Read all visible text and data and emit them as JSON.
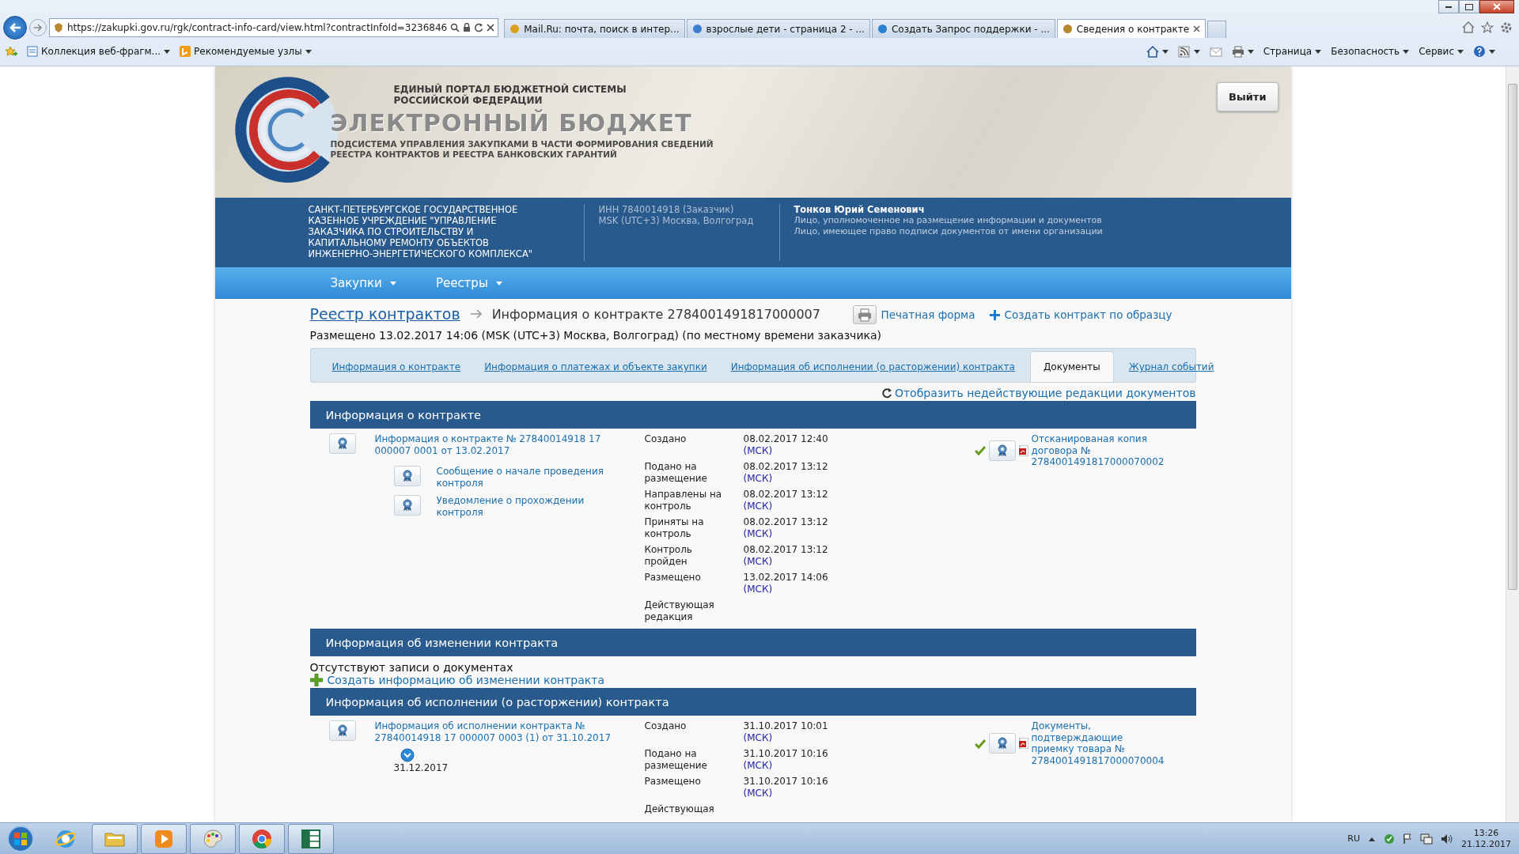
{
  "browser": {
    "url": "https://zakupki.gov.ru/rgk/contract-info-card/view.html?contractInfoId=3236846",
    "tabs": [
      {
        "title": "Mail.Ru: почта, поиск в интер...",
        "selected": false
      },
      {
        "title": "взрослые дети - страница 2 - ...",
        "selected": false
      },
      {
        "title": "Создать Запрос поддержки - ...",
        "selected": false
      },
      {
        "title": "Сведения о контракте",
        "selected": true
      }
    ],
    "favorites": [
      {
        "label": "Коллекция веб-фрагм..."
      },
      {
        "label": "Рекомендуемые узлы"
      }
    ],
    "commands": [
      {
        "label": "Страница"
      },
      {
        "label": "Безопасность"
      },
      {
        "label": "Сервис"
      }
    ]
  },
  "header": {
    "portal": [
      "ЕДИНЫЙ ПОРТАЛ БЮДЖЕТНОЙ СИСТЕМЫ",
      "РОССИЙСКОЙ ФЕДЕРАЦИИ"
    ],
    "title": "ЭЛЕКТРОННЫЙ БЮДЖЕТ",
    "subsystem": [
      "ПОДСИСТЕМА УПРАВЛЕНИЯ ЗАКУПКАМИ В ЧАСТИ ФОРМИРОВАНИЯ СВЕДЕНИЙ",
      "РЕЕСТРА КОНТРАКТОВ И РЕЕСТРА БАНКОВСКИХ ГАРАНТИЙ"
    ],
    "logout": "Выйти"
  },
  "organization": {
    "name_lines": [
      "САНКТ-ПЕТЕРБУРГСКОЕ ГОСУДАРСТВЕННОЕ",
      "КАЗЕННОЕ УЧРЕЖДЕНИЕ \"УПРАВЛЕНИЕ",
      "ЗАКАЗЧИКА ПО СТРОИТЕЛЬСТВУ И",
      "КАПИТАЛЬНОМУ РЕМОНТУ ОБЪЕКТОВ",
      "ИНЖЕНЕРНО-ЭНЕРГЕТИЧЕСКОГО КОМПЛЕКСА\""
    ],
    "inn": "ИНН 7840014918 (Заказчик)",
    "timezone": "MSK (UTC+3) Москва, Волгоград",
    "user": "Тонков Юрий Семенович",
    "roles": [
      "Лицо, уполномоченное на размещение информации и документов",
      "Лицо, имеющее право подписи документов от имени организации"
    ]
  },
  "nav": [
    {
      "label": "Закупки"
    },
    {
      "label": "Реестры"
    }
  ],
  "breadcrumb": {
    "link": "Реестр контрактов",
    "current": "Информация о контракте 2784001491817000007"
  },
  "actions": [
    {
      "kind": "print",
      "label": "Печатная форма"
    },
    {
      "kind": "create",
      "label": "Создать контракт по образцу"
    }
  ],
  "placed": "Размещено 13.02.2017 14:06 (MSK (UTC+3) Москва, Волгоград) (по местному времени заказчика)",
  "tabs": [
    {
      "label": "Информация о контракте",
      "selected": false
    },
    {
      "label": "Информация о платежах и объекте закупки",
      "selected": false
    },
    {
      "label": "Информация об исполнении (о расторжении) контракта",
      "selected": false
    },
    {
      "label": "Документы",
      "selected": true
    },
    {
      "label": "Журнал событий",
      "selected": false
    }
  ],
  "show_inactive": "Отобразить недействующие редакции документов",
  "sections": [
    {
      "title": "Информация о контракте",
      "kind": "documents",
      "documents": [
        {
          "title": "Информация о контракте № 27840014918 17 000007 0001 от 13.02.2017",
          "children": [
            {
              "title": "Сообщение о начале проведения контроля"
            },
            {
              "title": "Уведомление о прохождении контроля"
            }
          ],
          "events": [
            {
              "label": "Создано",
              "date": "08.02.2017 12:40",
              "tz": "(МСК)"
            },
            {
              "label": "Подано на размещение",
              "date": "08.02.2017 13:12",
              "tz": "(МСК)"
            },
            {
              "label": "Направлены на контроль",
              "date": "08.02.2017 13:12",
              "tz": "(МСК)"
            },
            {
              "label": "Приняты на контроль",
              "date": "08.02.2017 13:12",
              "tz": "(МСК)"
            },
            {
              "label": "Контроль пройден",
              "date": "08.02.2017 13:12",
              "tz": "(МСК)"
            },
            {
              "label": "Размещено",
              "date": "13.02.2017 14:06",
              "tz": "(МСК)"
            },
            {
              "label": "Действующая редакция"
            }
          ],
          "attachments": [
            {
              "title": "Отсканированая копия договора № 2784001491817000070002",
              "signed": true
            }
          ]
        }
      ]
    },
    {
      "title": "Информация об изменении контракта",
      "kind": "empty",
      "empty_text": "Отсутствуют записи о документах",
      "create_link": "Создать информацию об изменении контракта"
    },
    {
      "title": "Информация об исполнении (о расторжении) контракта",
      "kind": "documents",
      "documents": [
        {
          "title": "Информация об исполнении контракта № 27840014918 17 000007 0003 (1) от 31.10.2017",
          "expander": {
            "expanded": false
          },
          "date": "31.12.2017",
          "events": [
            {
              "label": "Создано",
              "date": "31.10.2017 10:01",
              "tz": "(МСК)"
            },
            {
              "label": "Подано на размещение",
              "date": "31.10.2017 10:16",
              "tz": "(МСК)"
            },
            {
              "label": "Размещено",
              "date": "31.10.2017 10:16",
              "tz": "(МСК)"
            },
            {
              "label": "Действующая"
            }
          ],
          "attachments": [
            {
              "title": "Документы, подтверждающие приемку товара № 2784001491817000070004",
              "signed": true
            }
          ]
        }
      ]
    }
  ],
  "taskbar": {
    "apps": [
      {
        "kind": "globe",
        "running": false
      },
      {
        "kind": "folder",
        "running": true
      },
      {
        "kind": "media",
        "running": true
      },
      {
        "kind": "paint",
        "running": true
      },
      {
        "kind": "chrome",
        "running": true
      },
      {
        "kind": "spreadsheet",
        "running": true
      }
    ]
  },
  "tray": {
    "language": "RU",
    "time": "13:26",
    "date": "21.12.2017"
  }
}
